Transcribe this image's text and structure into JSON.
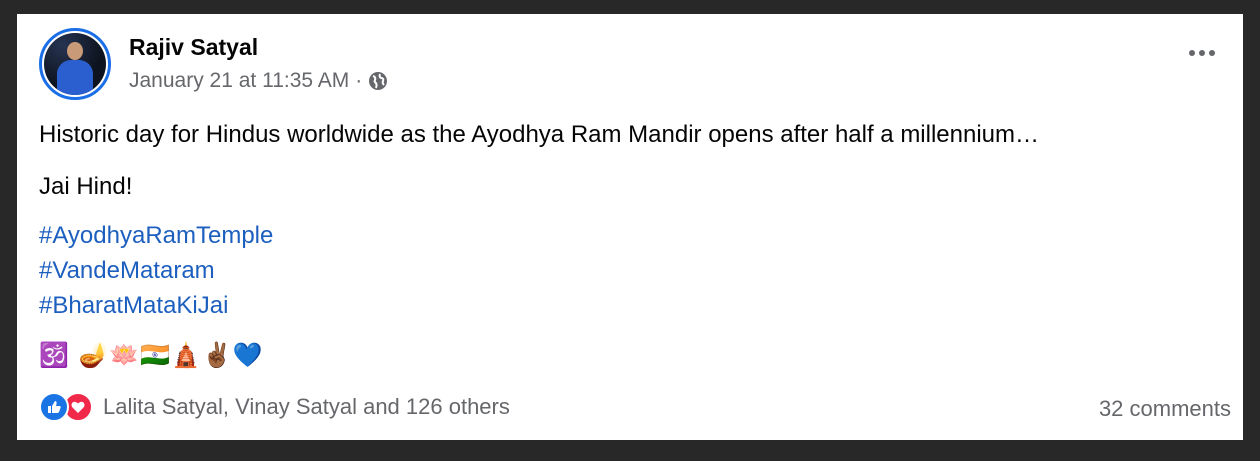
{
  "post": {
    "author": "Rajiv Satyal",
    "timestamp": "January 21 at 11:35 AM",
    "separator": "·",
    "privacy_icon": "globe-icon",
    "more_icon": "more-horizontal-icon",
    "text": "Historic day for Hindus worldwide as the Ayodhya Ram Mandir opens after half a millennium…",
    "text2": "Jai Hind!",
    "hashtags": [
      "#AyodhyaRamTemple",
      "#VandeMataram",
      "#BharatMataKiJai"
    ],
    "emojis": "🕉️ 🪔🪷🇮🇳🛕✌🏾💙"
  },
  "footer": {
    "reaction_icons": [
      "like-icon",
      "love-icon"
    ],
    "reactions_text": "Lalita Satyal, Vinay Satyal and 126 others",
    "comments_text": "32 comments"
  },
  "colors": {
    "background": "#282828",
    "card": "#ffffff",
    "hashtag": "#1d5fbf",
    "secondary_text": "#65676b",
    "like": "#1b74e4",
    "love": "#f0284a",
    "avatar_ring": "#1a6ee6"
  }
}
